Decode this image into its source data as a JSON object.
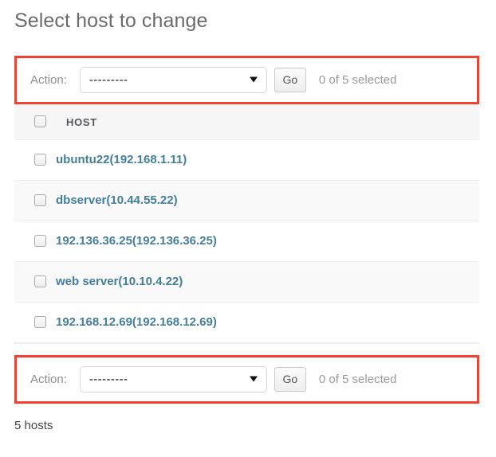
{
  "page": {
    "title": "Select host to change",
    "result_count": "5 hosts"
  },
  "action_bar_top": {
    "label": "Action:",
    "selected_option": "---------",
    "go_label": "Go",
    "selection_counter": "0 of 5 selected",
    "highlight_color": "#f4402e"
  },
  "action_bar_bottom": {
    "label": "Action:",
    "selected_option": "---------",
    "go_label": "Go",
    "selection_counter": "0 of 5 selected",
    "highlight_color": "#f4402e"
  },
  "table": {
    "column_header": "HOST",
    "rows": [
      {
        "host": "ubuntu22(192.168.1.11)"
      },
      {
        "host": "dbserver(10.44.55.22)"
      },
      {
        "host": "192.136.36.25(192.136.36.25)"
      },
      {
        "host": "web server(10.10.4.22)"
      },
      {
        "host": "192.168.12.69(192.168.12.69)"
      }
    ]
  },
  "colors": {
    "link": "#447e9b",
    "title": "#6b6b6b",
    "muted": "#999999",
    "row_alt": "#f9f9f9",
    "header_row": "#f6f6f6"
  }
}
